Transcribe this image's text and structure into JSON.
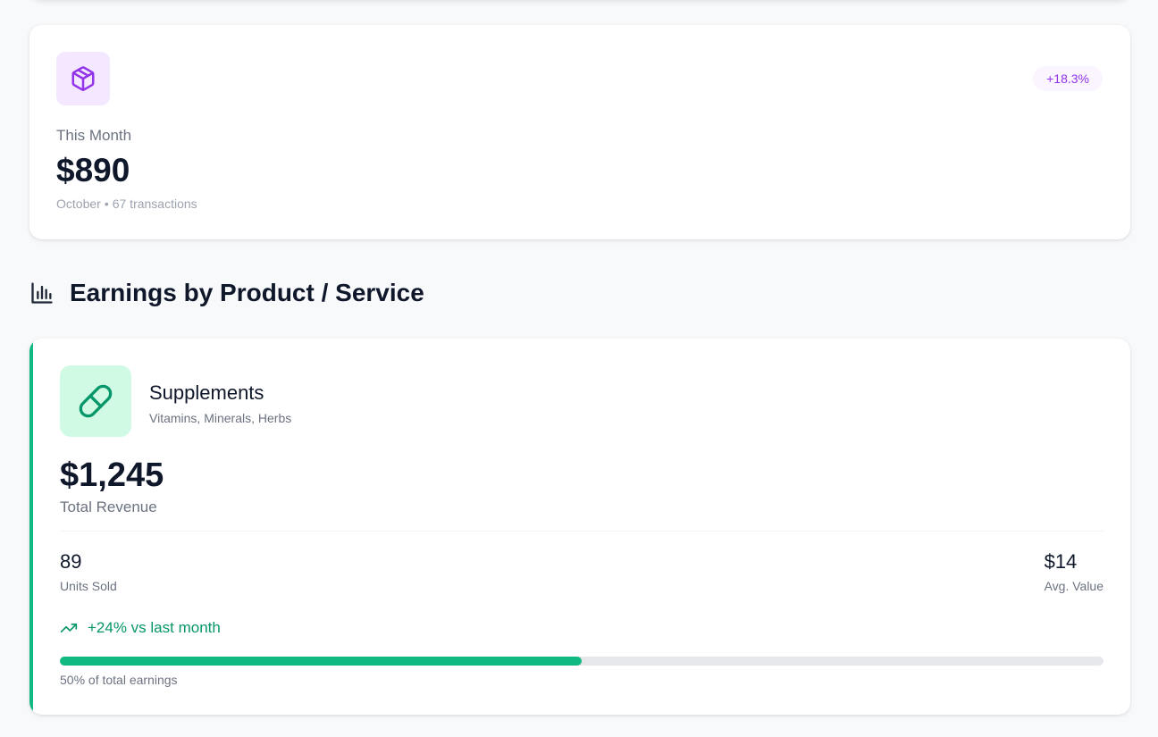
{
  "colors": {
    "month_accent": "#9333ea",
    "month_icon_bg": "#f3e8ff",
    "product_accent": "#10b981",
    "product_icon_bg": "#d1fae5",
    "trend_text": "#059669"
  },
  "month_card": {
    "icon": "package-icon",
    "badge": "+18.3%",
    "label": "This Month",
    "amount": "$890",
    "month": "October",
    "separator": "•",
    "transactions": "67 transactions"
  },
  "section": {
    "icon": "bar-chart-icon",
    "title": "Earnings by Product / Service"
  },
  "product": {
    "icon": "pill-icon",
    "name": "Supplements",
    "description": "Vitamins, Minerals, Herbs",
    "revenue": "$1,245",
    "revenue_label": "Total Revenue",
    "units_value": "89",
    "units_label": "Units Sold",
    "avg_value": "$14",
    "avg_label": "Avg. Value",
    "trend_icon": "trending-up-icon",
    "trend_text": "+24% vs last month",
    "share_fraction": 0.5,
    "share_label": "50% of total earnings"
  }
}
